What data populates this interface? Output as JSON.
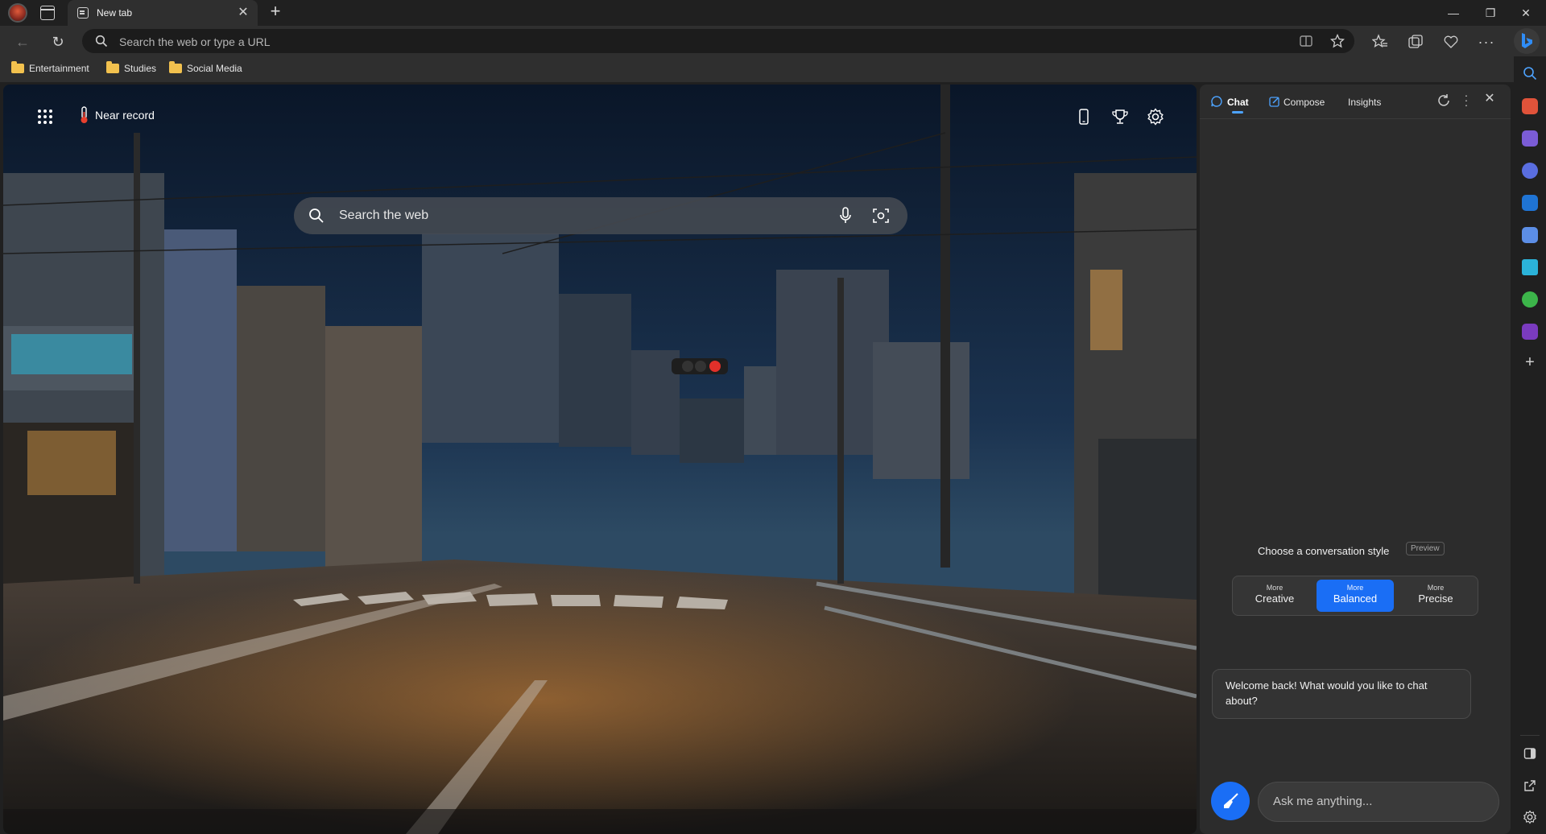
{
  "browser": {
    "tab": {
      "title": "New tab"
    },
    "address_bar": {
      "placeholder": "Search the web or type a URL"
    },
    "favorites": [
      {
        "label": "Entertainment"
      },
      {
        "label": "Studies"
      },
      {
        "label": "Social Media"
      }
    ]
  },
  "new_tab_page": {
    "weather_label": "Near record",
    "search": {
      "placeholder": "Search the web"
    }
  },
  "copilot": {
    "tabs": [
      {
        "label": "Chat",
        "active": true
      },
      {
        "label": "Compose",
        "active": false
      },
      {
        "label": "Insights",
        "active": false
      }
    ],
    "style_prompt": "Choose a conversation style",
    "preview_badge": "Preview",
    "styles": [
      {
        "top": "More",
        "label": "Creative",
        "selected": false
      },
      {
        "top": "More",
        "label": "Balanced",
        "selected": true
      },
      {
        "top": "More",
        "label": "Precise",
        "selected": false
      }
    ],
    "welcome_message": "Welcome back! What would you like to chat about?",
    "input": {
      "placeholder": "Ask me anything..."
    }
  },
  "colors": {
    "accent": "#1a6ef5",
    "panel_bg": "#2c2c2c",
    "chrome_bg": "#2f2f2f"
  }
}
